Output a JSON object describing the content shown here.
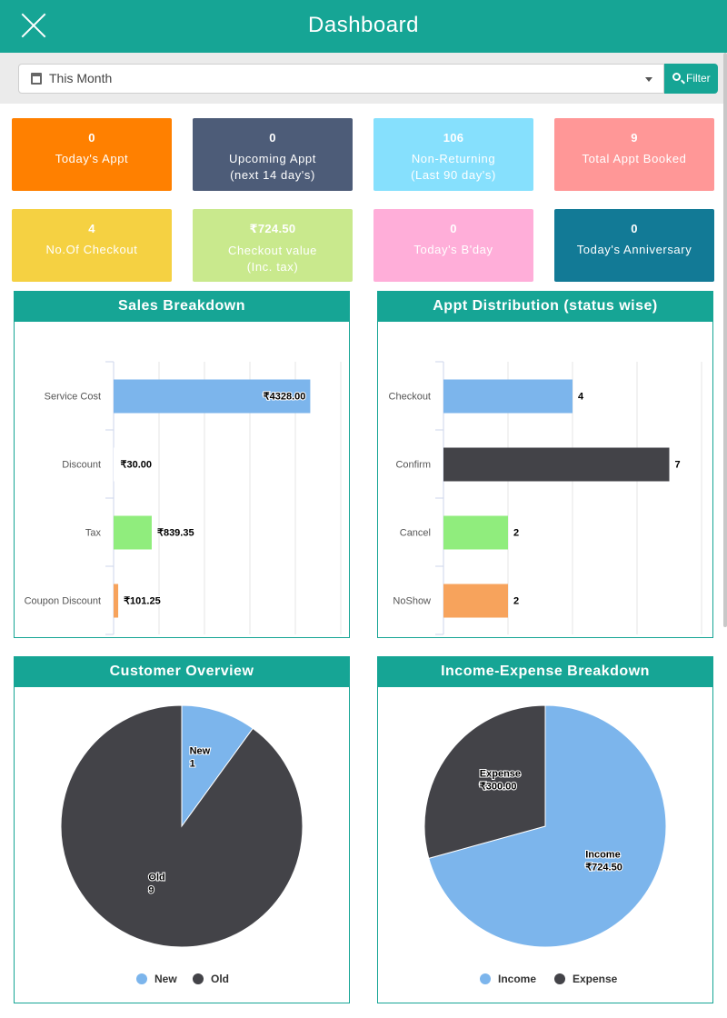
{
  "header": {
    "title": "Dashboard"
  },
  "filter": {
    "period": "This Month",
    "button_label": "Filter"
  },
  "stats": [
    {
      "value": "0",
      "label": "Today's Appt",
      "color": "#ff8000",
      "text_color": "#ffffff"
    },
    {
      "value": "0",
      "label": "Upcoming Appt\n(next 14 day's)",
      "color": "#4d5c78",
      "text_color": "#ffffff"
    },
    {
      "value": "106",
      "label": "Non-Returning\n(Last 90 day's)",
      "color": "#86e0fd",
      "text_color": "#ffffff"
    },
    {
      "value": "9",
      "label": "Total Appt Booked",
      "color": "#ff9797",
      "text_color": "#ffffff"
    },
    {
      "value": "4",
      "label": "No.Of Checkout",
      "color": "#f5d142",
      "text_color": "#ffffff"
    },
    {
      "value": "₹724.50",
      "label": "Checkout value\n(Inc. tax)",
      "color": "#c9e98d",
      "text_color": "#ffffff"
    },
    {
      "value": "0",
      "label": "Today's B'day",
      "color": "#ffaed9",
      "text_color": "#ffffff"
    },
    {
      "value": "0",
      "label": "Today's Anniversary",
      "color": "#127a96",
      "text_color": "#ffffff"
    }
  ],
  "chart_data": [
    {
      "type": "bar",
      "orientation": "horizontal",
      "title": "Sales Breakdown",
      "categories": [
        "Service Cost",
        "Discount",
        "Tax",
        "Coupon Discount"
      ],
      "values": [
        4328.0,
        30.0,
        839.35,
        101.25
      ],
      "data_labels": [
        "₹4328.00",
        "₹30.00",
        "₹839.35",
        "₹101.25"
      ],
      "colors": [
        "#7cb5ec",
        "#ffffff",
        "#90ed7d",
        "#f7a35c"
      ],
      "xlim": [
        0,
        5000
      ],
      "x_ticks": [
        0,
        1000,
        2000,
        3000,
        4000,
        5000
      ],
      "x_tick_labels": [
        "0",
        "1k",
        "2k",
        "3k",
        "4k",
        "5k"
      ],
      "grid": true
    },
    {
      "type": "bar",
      "orientation": "horizontal",
      "title": "Appt Distribution (status wise)",
      "categories": [
        "Checkout",
        "Confirm",
        "Cancel",
        "NoShow"
      ],
      "values": [
        4,
        7,
        2,
        2
      ],
      "data_labels": [
        "4",
        "7",
        "2",
        "2"
      ],
      "colors": [
        "#7cb5ec",
        "#434348",
        "#90ed7d",
        "#f7a35c"
      ],
      "xlim": [
        0,
        8
      ],
      "x_ticks": [
        0,
        2,
        4,
        6,
        8
      ],
      "x_tick_labels": [
        "0",
        "2",
        "4",
        "6",
        "8"
      ],
      "grid": true
    },
    {
      "type": "pie",
      "title": "Customer Overview",
      "categories": [
        "New",
        "Old"
      ],
      "values": [
        1,
        9
      ],
      "slice_labels": [
        [
          "New",
          "1"
        ],
        [
          "Old",
          "9"
        ]
      ],
      "colors": [
        "#7cb5ec",
        "#434348"
      ],
      "legend": "bottom"
    },
    {
      "type": "pie",
      "title": "Income-Expense Breakdown",
      "categories": [
        "Income",
        "Expense"
      ],
      "values": [
        724.5,
        300.0
      ],
      "slice_labels": [
        [
          "Income",
          "₹724.50"
        ],
        [
          "Expense",
          "₹300.00"
        ]
      ],
      "colors": [
        "#7cb5ec",
        "#434348"
      ],
      "legend": "bottom"
    }
  ]
}
